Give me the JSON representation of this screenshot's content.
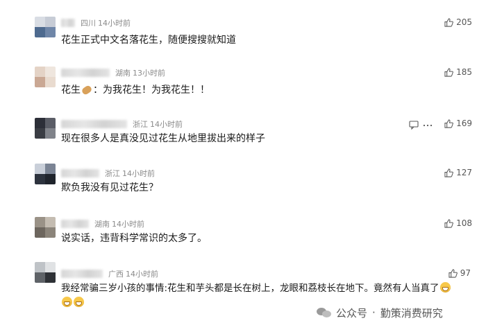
{
  "comments": [
    {
      "location": "四川",
      "time": "14小时前",
      "likes": "205",
      "text": "花生正式中文名落花生，随便搜搜就知道",
      "avatar_colors": [
        "#d9dde4",
        "#c7ccd6",
        "#4e6a8f",
        "#6f86a8"
      ]
    },
    {
      "location": "湖南",
      "time": "13小时前",
      "likes": "185",
      "text_before": "花生",
      "text_after": "：为我花生！为我花生！！",
      "avatar_colors": [
        "#e4d3c6",
        "#efe6de",
        "#caa894",
        "#e9dbcf"
      ]
    },
    {
      "location": "浙江",
      "time": "14小时前",
      "likes": "169",
      "text": "现在很多人是真没见过花生从地里拔出来的样子",
      "avatar_colors": [
        "#2c2f38",
        "#5a5d66",
        "#3a3d44",
        "#80838a"
      ]
    },
    {
      "location": "浙江",
      "time": "14小时前",
      "likes": "127",
      "text": "欺负我没有见过花生？",
      "avatar_colors": [
        "#c9cfd9",
        "#7b8494",
        "#2d333e",
        "#1f242c"
      ]
    },
    {
      "location": "湖南",
      "time": "14小时前",
      "likes": "108",
      "text": "说实话，违背科学常识的太多了。",
      "avatar_colors": [
        "#9a9287",
        "#c4bcb1",
        "#6d665e",
        "#8b847a"
      ]
    },
    {
      "location": "广西",
      "time": "14小时前",
      "likes": "97",
      "text_line1": "我经常骗三岁小孩的事情:花生和芋头都是长在树上，龙眼和荔枝长在地下。竟然有人当真了",
      "avatar_colors": [
        "#bfc3c7",
        "#e0e2e4",
        "#5f6368",
        "#2e3136"
      ]
    }
  ],
  "watermark": {
    "prefix": "公众号",
    "separator": "·",
    "name": "勤策消费研究"
  },
  "icons": {
    "like": "thumbs-up-icon",
    "reply": "reply-icon",
    "more": "more-icon",
    "emoji": "grinning-emoji-icon",
    "peanut": "peanut-emoji-icon",
    "watermark": "wechat-icon"
  }
}
